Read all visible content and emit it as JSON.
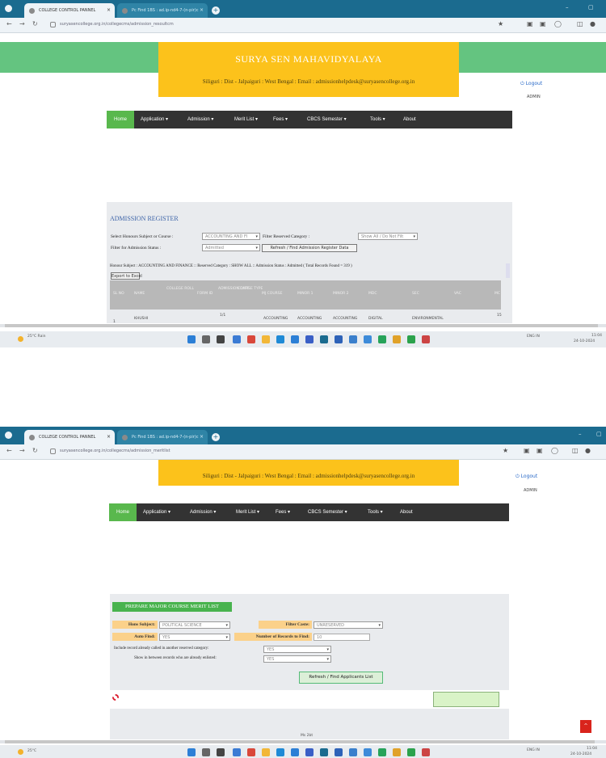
{
  "shot1": {
    "browser": {
      "tab_active": "COLLEGE CONTROL PANNEL",
      "tab_inactive": "Pc Find 1BS : ad.ip-nd4-7-(n-pir)c",
      "url": "suryasencollege.org.in/collegecms/admission_resoultcm",
      "win_buttons": [
        "–",
        "▢"
      ]
    },
    "header": {
      "title": "SURYA SEN MAHAVIDYALAYA",
      "subtitle": "Siliguri : Dist - Jalpaiguri : West Bengal : Email : admissionhelpdesk@suryasencollege.org.in"
    },
    "logout_label": "Logout",
    "admin_label": "ADMIN",
    "menu": [
      "Home",
      "Application ▾",
      "Admission ▾",
      "Merit List ▾",
      "Fees ▾",
      "CBCS Semester ▾",
      "Tools ▾",
      "About"
    ],
    "register": {
      "title": "ADMISSION REGISTER",
      "course_label": "Select Honours Subject or Course :",
      "course_value": "ACCOUNTING AND FI",
      "reserved_label": "Filter Reserved Category :",
      "reserved_value": "Show All / Do Not Filt",
      "status_label": "Filter for Admission Status :",
      "status_value": "Admitted",
      "refresh_label": "Refresh / Find Admission Register Data",
      "summary": "Honour Subject : ACCOUNTING AND FINANCE :: Reserved Category : SHOW ALL :: Admission Status : Admitted ( Total Records Found = 319 )",
      "excel_label": "Export to Excel",
      "columns": [
        "SL NO",
        "NAME",
        "COLLEGE ROLL",
        "FORM ID",
        "ADMISSION DATE",
        "COURSE TYPE",
        "MJ COURSE",
        "MINOR 1",
        "MINOR 2",
        "MDC",
        "SEC",
        "VAC",
        "MC"
      ],
      "row": [
        "1",
        "KHUSHI",
        "",
        "",
        "1/1",
        "",
        "ACCOUNTING",
        "ACCOUNTING",
        "ACCOUNTING",
        "DIGITAL",
        "ENVIRONMENTAL",
        "",
        "15"
      ]
    },
    "taskbar": {
      "weather": "25°C Rain",
      "time": "11:04",
      "date": "24-10-2024",
      "lang": "ENG IN"
    }
  },
  "shot2": {
    "browser": {
      "tab_active": "COLLEGE CONTROL PANNEL",
      "tab_inactive": "Pc Find 1BS : ad.ip-nd4-7-(n-pir)c",
      "url": "suryasencollege.org.in/collegecms/admission_meritlist",
      "win_buttons": [
        "–",
        "▢"
      ]
    },
    "header": {
      "subtitle": "Siliguri : Dist - Jalpaiguri : West Bengal : Email : admissionhelpdesk@suryasencollege.org.in"
    },
    "logout_label": "Logout",
    "admin_label": "ADMIN",
    "menu": [
      "Home",
      "Application ▾",
      "Admission ▾",
      "Merit List ▾",
      "Fees ▾",
      "CBCS Semester ▾",
      "Tools ▾",
      "About"
    ],
    "merit": {
      "title": "PREPARE MAJOR COURSE MERIT LIST",
      "hons_label": "Hons Subject:",
      "hons_value": "POLITICAL SCIENCE",
      "filter_label": "Filter Caste:",
      "filter_value": "UNRESERVED",
      "auto_label": "Auto Find:",
      "auto_value": "YES",
      "records_label": "Number of Records to Find:",
      "records_value": "10",
      "include_label": "Include record already called in another reserved category:",
      "include_value": "YES",
      "show_label": "Show in between records who are already enlisted:",
      "show_value": "YES",
      "refresh_label": "Refresh / Find Applicants List"
    },
    "footer": "Ms 2bt",
    "taskbar": {
      "weather": "25°C",
      "time": "11:04",
      "date": "24-10-2024",
      "lang": "ENG IN"
    }
  },
  "colors": {
    "tabbar": "#1b6b8f",
    "green_bar": "#64c480",
    "header": "#fcc21b",
    "menu": "#333333",
    "home": "#59b84d"
  }
}
